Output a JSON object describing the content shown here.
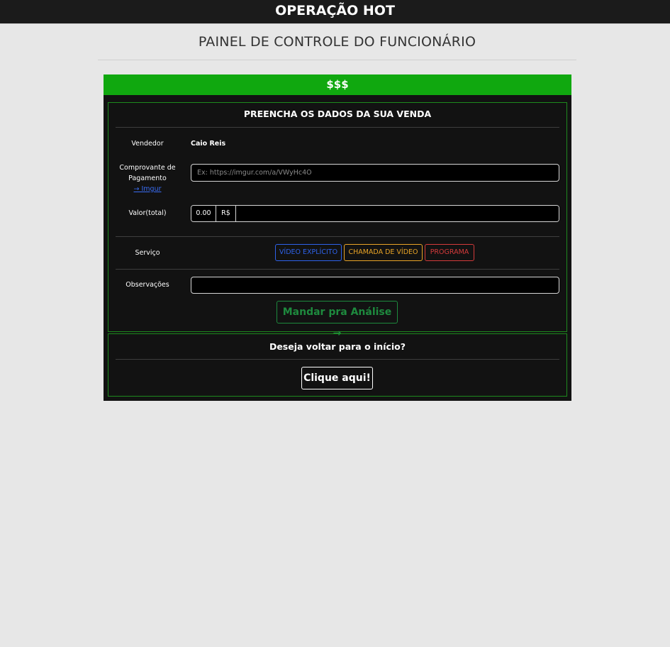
{
  "app": {
    "title": "OPERAÇÃO HOT"
  },
  "page": {
    "title": "PAINEL DE CONTROLE DO FUNCIONÁRIO"
  },
  "panel": {
    "header": "$$$",
    "form": {
      "title": "PREENCHA OS DADOS DA SUA VENDA",
      "vendedor": {
        "label": "Vendedor",
        "value": "Caio Reis"
      },
      "comprovante": {
        "label_line1": "Comprovante de",
        "label_line2": "Pagamento",
        "link": "→ Imgur",
        "placeholder": "Ex: https://imgur.com/a/VWyHc4O",
        "value": ""
      },
      "valor": {
        "label": "Valor(total)",
        "amount": "0.00",
        "currency": "R$",
        "value": ""
      },
      "servico": {
        "label": "Serviço",
        "options": [
          "VÍDEO EXPLÍCITO",
          "CHAMADA DE VÍDEO",
          "PROGRAMA"
        ]
      },
      "observacoes": {
        "label": "Observações",
        "value": ""
      },
      "submit_label": "Mandar pra Análise →"
    },
    "back": {
      "title": "Deseja voltar para o início?",
      "button_label": "Clique aqui!"
    }
  },
  "colors": {
    "topbar": "#1b1b1b",
    "header_green": "#10a80f",
    "panel_bg": "#121212",
    "box_border": "#1e8a1e",
    "svc_blue": "#2e62ea",
    "svc_orange": "#e8a326",
    "svc_red": "#d33a3a",
    "submit_green": "#1e8a3e"
  }
}
